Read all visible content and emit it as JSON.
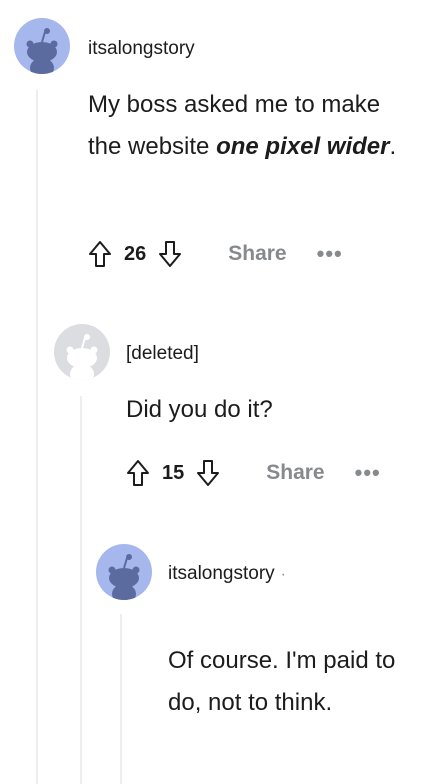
{
  "comments": [
    {
      "username": "itsalongstory",
      "body_plain": "My boss asked me to make the website ",
      "body_emph": "one pixel wider",
      "body_end": ".",
      "score": "26",
      "share_label": "Share",
      "more_label": "•••",
      "avatar_icon": "snoo-avatar-icon"
    },
    {
      "username": "[deleted]",
      "body": "Did you do it?",
      "score": "15",
      "share_label": "Share",
      "more_label": "•••",
      "avatar_icon": "deleted-user-avatar-icon"
    },
    {
      "username": "itsalongstory",
      "separator": "·",
      "body": "Of course. I'm paid to do, not to think.",
      "avatar_icon": "snoo-avatar-icon"
    }
  ],
  "colors": {
    "avatar_bg": "#a5b7ec",
    "snoo": "#5b6b9f",
    "thread_line": "#eeeeee",
    "muted": "#878a8c"
  }
}
